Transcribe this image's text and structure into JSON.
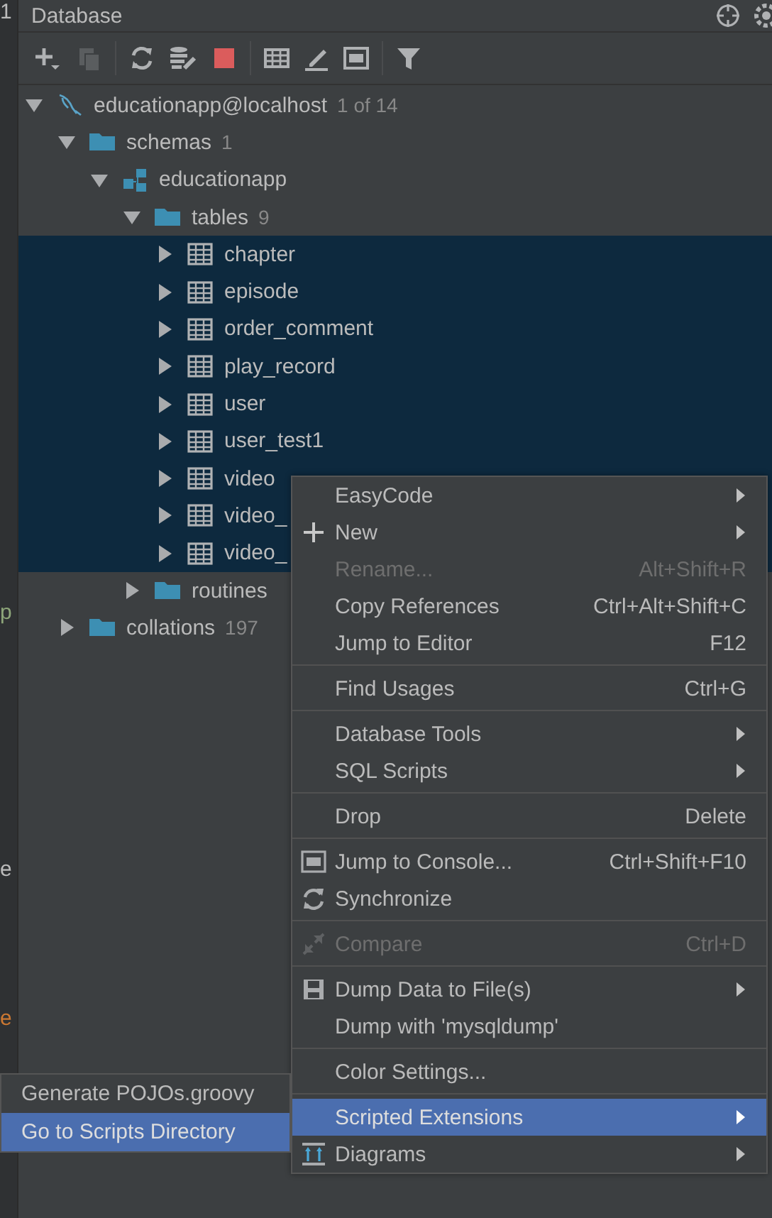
{
  "editor_strip": {
    "fragments": [
      {
        "text": "1",
        "color": "#bbbbbb"
      },
      {
        "text": "p",
        "color": "#8ea67a"
      },
      {
        "text": "e",
        "color": "#bbbbbb"
      },
      {
        "text": "e",
        "color": "#cc7832"
      }
    ]
  },
  "panel": {
    "title": "Database"
  },
  "tree": [
    {
      "kind": "connection",
      "label": "educationapp@localhost",
      "count": "1 of 14",
      "expanded": true,
      "selected": false,
      "children": [
        {
          "kind": "folder",
          "label": "schemas",
          "count": "1",
          "expanded": true,
          "selected": false,
          "children": [
            {
              "kind": "schema",
              "label": "educationapp",
              "expanded": true,
              "selected": false,
              "children": [
                {
                  "kind": "folder",
                  "label": "tables",
                  "count": "9",
                  "expanded": true,
                  "selected": false,
                  "children": [
                    {
                      "kind": "table",
                      "label": "chapter",
                      "expanded": false,
                      "selected": true
                    },
                    {
                      "kind": "table",
                      "label": "episode",
                      "expanded": false,
                      "selected": true
                    },
                    {
                      "kind": "table",
                      "label": "order_comment",
                      "expanded": false,
                      "selected": true
                    },
                    {
                      "kind": "table",
                      "label": "play_record",
                      "expanded": false,
                      "selected": true
                    },
                    {
                      "kind": "table",
                      "label": "user",
                      "expanded": false,
                      "selected": true
                    },
                    {
                      "kind": "table",
                      "label": "user_test1",
                      "expanded": false,
                      "selected": true
                    },
                    {
                      "kind": "table",
                      "label": "video",
                      "expanded": false,
                      "selected": true
                    },
                    {
                      "kind": "table",
                      "label": "video_",
                      "expanded": false,
                      "selected": true
                    },
                    {
                      "kind": "table",
                      "label": "video_",
                      "expanded": false,
                      "selected": true
                    }
                  ]
                },
                {
                  "kind": "folder",
                  "label": "routines",
                  "expanded": false,
                  "selected": false
                }
              ]
            }
          ]
        },
        {
          "kind": "folder",
          "label": "collations",
          "count": "197",
          "expanded": false,
          "selected": false
        }
      ]
    }
  ],
  "context_menu": {
    "items": [
      {
        "kind": "item",
        "label": "EasyCode",
        "submenu": true,
        "disabled": false,
        "selected": false
      },
      {
        "kind": "item",
        "label": "New",
        "submenu": true,
        "disabled": false,
        "selected": false
      },
      {
        "kind": "item",
        "label": "Rename...",
        "shortcut": "Alt+Shift+R",
        "submenu": false,
        "disabled": true,
        "selected": false
      },
      {
        "kind": "item",
        "label": "Copy References",
        "shortcut": "Ctrl+Alt+Shift+C",
        "submenu": false,
        "disabled": false,
        "selected": false
      },
      {
        "kind": "item",
        "label": "Jump to Editor",
        "shortcut": "F12",
        "submenu": false,
        "disabled": false,
        "selected": false
      },
      {
        "kind": "separator"
      },
      {
        "kind": "item",
        "label": "Find Usages",
        "shortcut": "Ctrl+G",
        "submenu": false,
        "disabled": false,
        "selected": false
      },
      {
        "kind": "separator"
      },
      {
        "kind": "item",
        "label": "Database Tools",
        "submenu": true,
        "disabled": false,
        "selected": false
      },
      {
        "kind": "item",
        "label": "SQL Scripts",
        "submenu": true,
        "disabled": false,
        "selected": false
      },
      {
        "kind": "separator"
      },
      {
        "kind": "item",
        "label": "Drop",
        "shortcut": "Delete",
        "submenu": false,
        "disabled": false,
        "selected": false
      },
      {
        "kind": "separator"
      },
      {
        "kind": "item",
        "label": "Jump to Console...",
        "shortcut": "Ctrl+Shift+F10",
        "submenu": false,
        "disabled": false,
        "selected": false
      },
      {
        "kind": "item",
        "label": "Synchronize",
        "submenu": false,
        "disabled": false,
        "selected": false
      },
      {
        "kind": "separator"
      },
      {
        "kind": "item",
        "label": "Compare",
        "shortcut": "Ctrl+D",
        "submenu": false,
        "disabled": true,
        "selected": false
      },
      {
        "kind": "separator"
      },
      {
        "kind": "item",
        "label": "Dump Data to File(s)",
        "submenu": true,
        "disabled": false,
        "selected": false
      },
      {
        "kind": "item",
        "label": "Dump with 'mysqldump'",
        "submenu": false,
        "disabled": false,
        "selected": false
      },
      {
        "kind": "separator"
      },
      {
        "kind": "item",
        "label": "Color Settings...",
        "submenu": false,
        "disabled": false,
        "selected": false
      },
      {
        "kind": "separator"
      },
      {
        "kind": "item",
        "label": "Scripted Extensions",
        "submenu": true,
        "disabled": false,
        "selected": true
      },
      {
        "kind": "item",
        "label": "Diagrams",
        "submenu": true,
        "disabled": false,
        "selected": false
      }
    ]
  },
  "submenu": {
    "items": [
      {
        "label": "Generate POJOs.groovy",
        "selected": false
      },
      {
        "label": "Go to Scripts Directory",
        "selected": true
      }
    ]
  }
}
